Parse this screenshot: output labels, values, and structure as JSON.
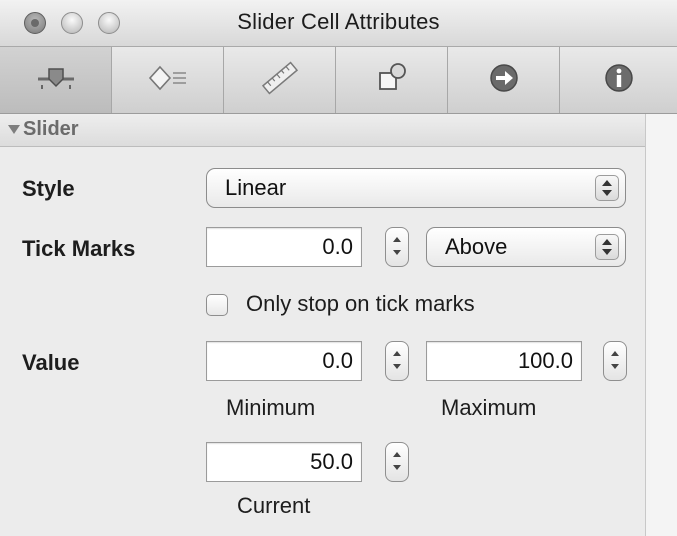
{
  "window": {
    "title": "Slider Cell Attributes"
  },
  "toolbar": {
    "tabs": [
      {
        "icon": "slider-attributes-icon",
        "selected": true
      },
      {
        "icon": "bindings-diamond-icon",
        "selected": false
      },
      {
        "icon": "ruler-size-icon",
        "selected": false
      },
      {
        "icon": "connections-icon",
        "selected": false
      },
      {
        "icon": "arrow-circle-icon",
        "selected": false
      },
      {
        "icon": "info-icon",
        "selected": false
      }
    ]
  },
  "section": {
    "title": "Slider"
  },
  "form": {
    "style_label": "Style",
    "style_value": "Linear",
    "tick_marks_label": "Tick Marks",
    "tick_marks_value": "0.0",
    "tick_position": "Above",
    "only_stop_label": "Only stop on tick marks",
    "only_stop_checked": false,
    "value_label": "Value",
    "minimum_value": "0.0",
    "minimum_caption": "Minimum",
    "maximum_value": "100.0",
    "maximum_caption": "Maximum",
    "current_value": "50.0",
    "current_caption": "Current"
  }
}
